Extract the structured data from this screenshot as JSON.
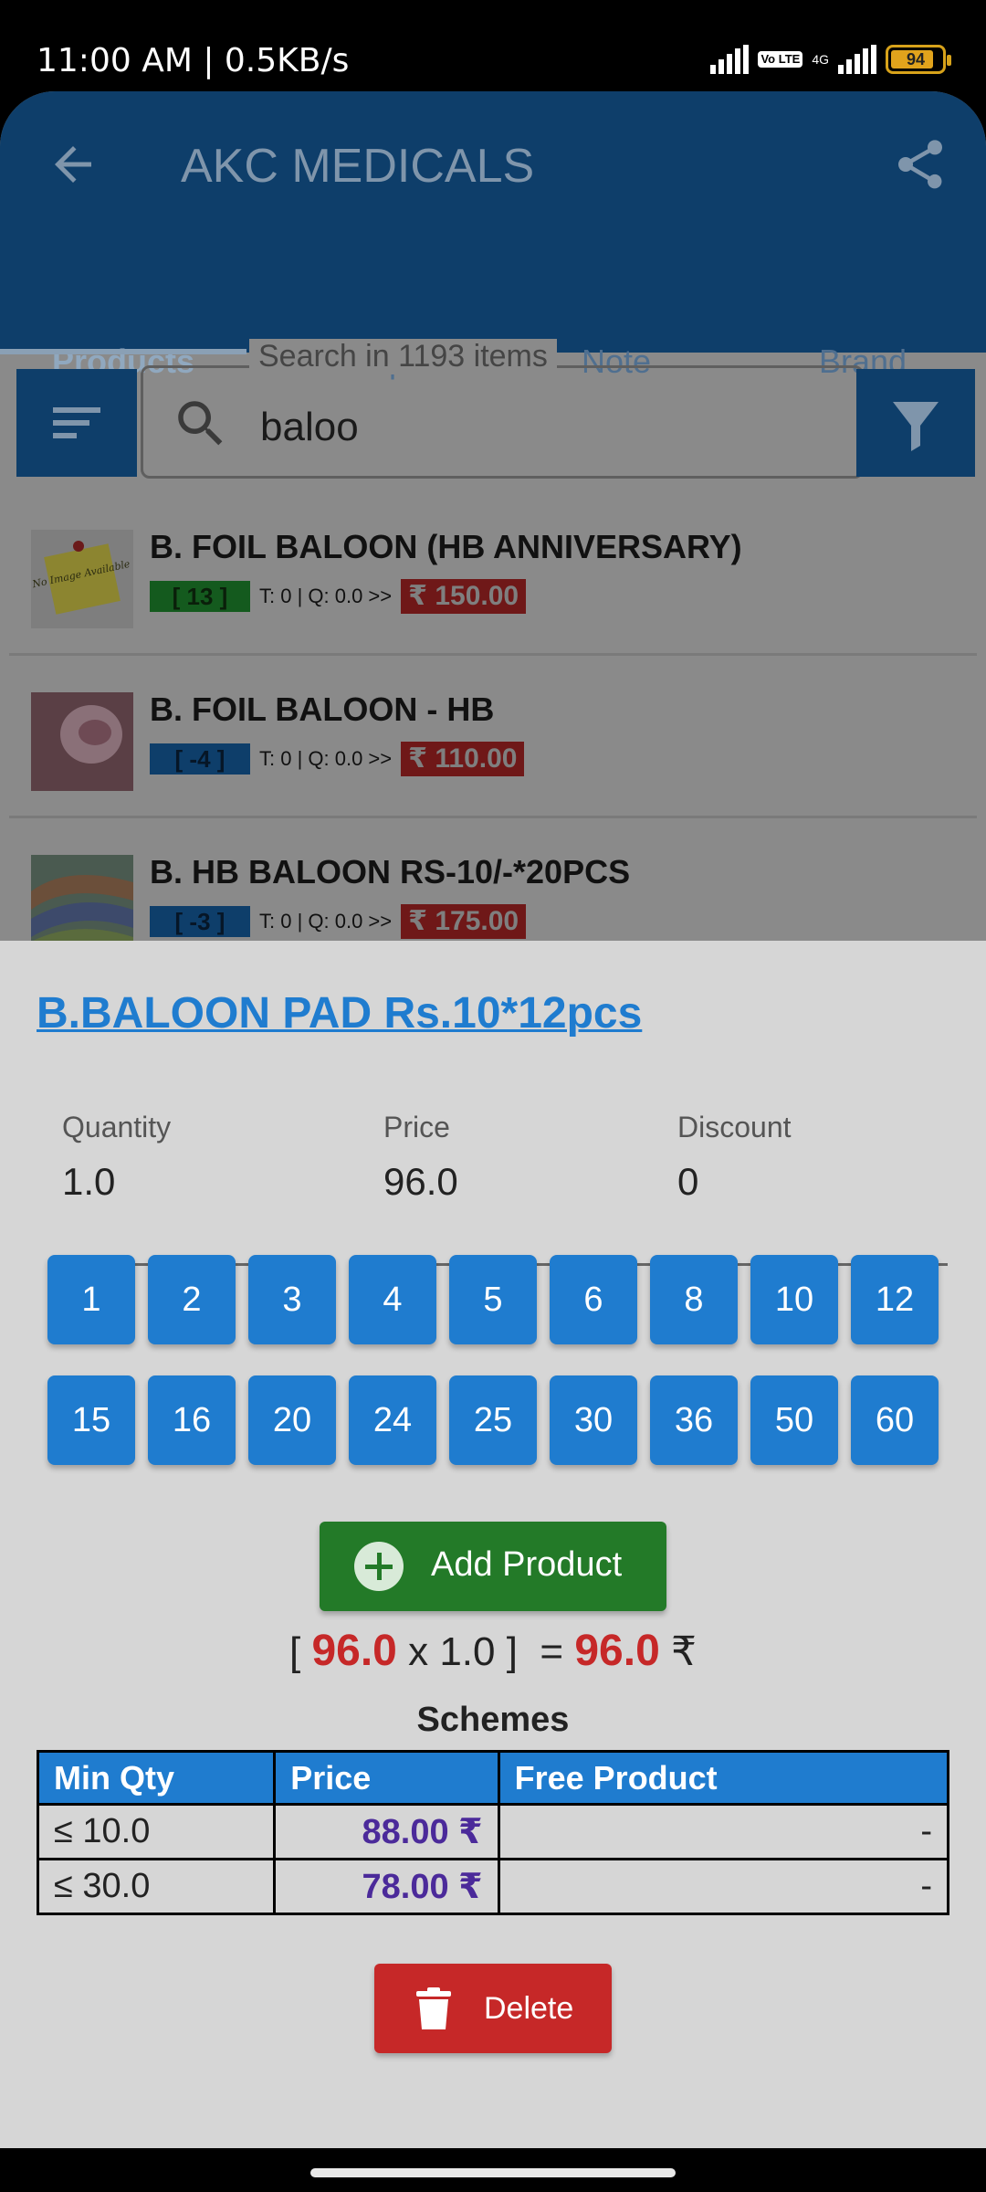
{
  "status_bar": {
    "time": "11:00 AM | 0.5KB/s",
    "volte": "Vo LTE",
    "network": "4G",
    "battery": "94"
  },
  "app": {
    "title": "AKC MEDICALS",
    "tabs": [
      "Products",
      "Groups",
      "Note",
      "Brand"
    ],
    "search": {
      "legend": "Search in 1193 items",
      "value": "baloo"
    },
    "products": [
      {
        "name": "B. FOIL BALOON (HB ANNIVERSARY)",
        "stock": "[ 13 ]",
        "stock_color": "#145a1e",
        "meta": "T: 0 | Q: 0.0 >>",
        "mrp": "₹ 150.00",
        "thumb_text": "No Image Available"
      },
      {
        "name": "B. FOIL BALOON - HB",
        "stock": "[ -4 ]",
        "stock_color": "#0e3e6a",
        "meta": "T: 0 | Q: 0.0 >>",
        "mrp": "₹ 110.00"
      },
      {
        "name": "B. HB BALOON RS-10/-*20PCS",
        "stock": "[ -3 ]",
        "stock_color": "#0e3e6a",
        "meta": "T: 0 | Q: 0.0 >>",
        "mrp": "₹ 175.00"
      }
    ]
  },
  "sheet": {
    "title": "B.BALOON PAD Rs.10*12pcs",
    "fields": {
      "quantity": {
        "label": "Quantity",
        "value": "1.0"
      },
      "price": {
        "label": "Price",
        "value": "96.0"
      },
      "discount": {
        "label": "Discount",
        "value": "0"
      }
    },
    "quick_qty": [
      "1",
      "2",
      "3",
      "4",
      "5",
      "6",
      "8",
      "10",
      "12",
      "15",
      "16",
      "20",
      "24",
      "25",
      "30",
      "36",
      "50",
      "60"
    ],
    "add_label": "Add Product",
    "calc": {
      "open": "[",
      "price": "96.0",
      "times": "x 1.0",
      "close": "]",
      "eq": "=",
      "total": "96.0",
      "currency": "₹"
    },
    "schemes_title": "Schemes",
    "schemes_headers": [
      "Min Qty",
      "Price",
      "Free Product"
    ],
    "schemes_rows": [
      {
        "min_qty": "≤ 10.0",
        "price": "88.00 ₹",
        "free": "-"
      },
      {
        "min_qty": "≤ 30.0",
        "price": "78.00 ₹",
        "free": "-"
      }
    ],
    "delete_label": "Delete"
  },
  "colors": {
    "primary": "#1f7ccf",
    "add_green": "#237a28",
    "delete_red": "#c62828",
    "price_purple": "#4b2a9a"
  }
}
